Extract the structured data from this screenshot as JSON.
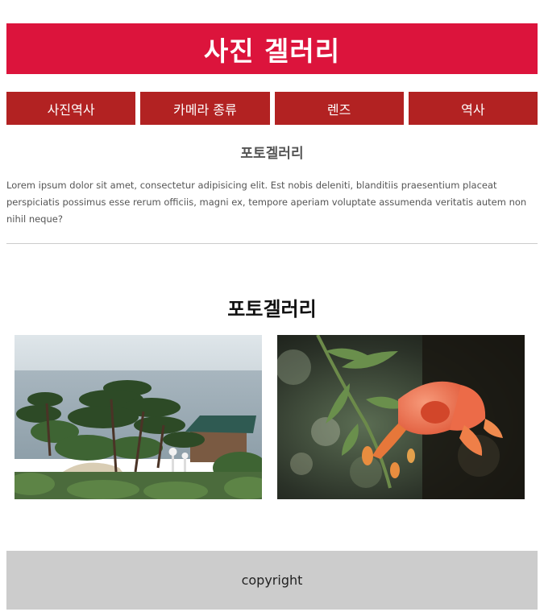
{
  "header": {
    "title": "사진 겔러리"
  },
  "nav": {
    "items": [
      {
        "label": "사진역사"
      },
      {
        "label": "카메라 종류"
      },
      {
        "label": "렌즈"
      },
      {
        "label": "역사"
      }
    ]
  },
  "intro": {
    "title": "포토겔러리",
    "text": "Lorem ipsum dolor sit amet, consectetur adipisicing elit. Est nobis deleniti, blanditiis praesentium placeat perspiciatis possimus esse rerum officiis, magni ex, tempore aperiam voluptate assumenda veritatis autem non nihil neque?"
  },
  "gallery": {
    "title": "포토겔러리",
    "photos": [
      {
        "subject": "coastal-pine-trees-photo"
      },
      {
        "subject": "orange-trumpet-flower-photo"
      }
    ]
  },
  "footer": {
    "text": "copyright"
  },
  "colors": {
    "header_bg": "#dc143c",
    "nav_bg": "#b22222",
    "footer_bg": "#cccccc"
  }
}
